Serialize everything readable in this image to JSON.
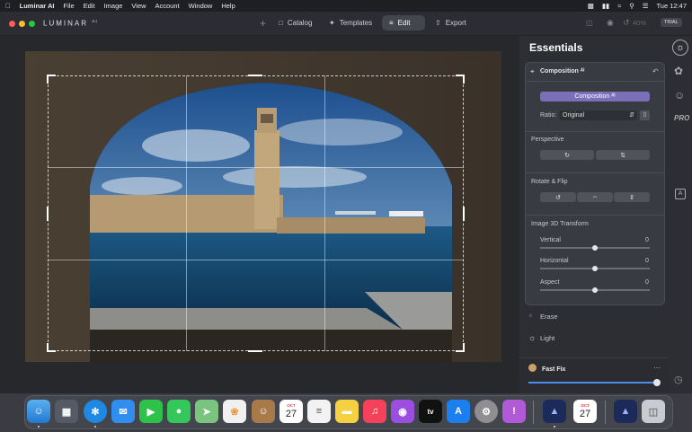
{
  "menubar": {
    "app_name": "Luminar AI",
    "menus": [
      "File",
      "Edit",
      "Image",
      "View",
      "Account",
      "Window",
      "Help"
    ],
    "clock": "Tue 12:47"
  },
  "toolbar": {
    "logo": "LUMINAR",
    "logo_sup": "A.I",
    "catalog": "Catalog",
    "templates": "Templates",
    "edit": "Edit",
    "export": "Export",
    "zoom": "40%",
    "trial": "TRIAL"
  },
  "panel": {
    "title": "Essentials",
    "card_title": "Composition ᴬᴵ",
    "composition_button": "Composition ᴬᴵ",
    "ratio_label": "Ratio:",
    "ratio_value": "Original",
    "perspective": "Perspective",
    "rotate_flip": "Rotate & Flip",
    "transform": "Image 3D Transform",
    "sliders": [
      {
        "label": "Vertical",
        "value": "0",
        "level": 0.5
      },
      {
        "label": "Horizontal",
        "value": "0",
        "level": 0.5
      },
      {
        "label": "Aspect",
        "value": "0",
        "level": 0.5
      }
    ],
    "erase": "Erase",
    "light": "Light",
    "fastfix": "Fast Fix",
    "fastfix_level": 1.0
  },
  "dock": {
    "calendar_month": "OCT",
    "calendar_day": "27",
    "tv_label": "tv"
  },
  "colors": {
    "accent": "#7a6fb8",
    "panel_bg": "#2c2e33",
    "canvas_bg": "#26282c"
  }
}
